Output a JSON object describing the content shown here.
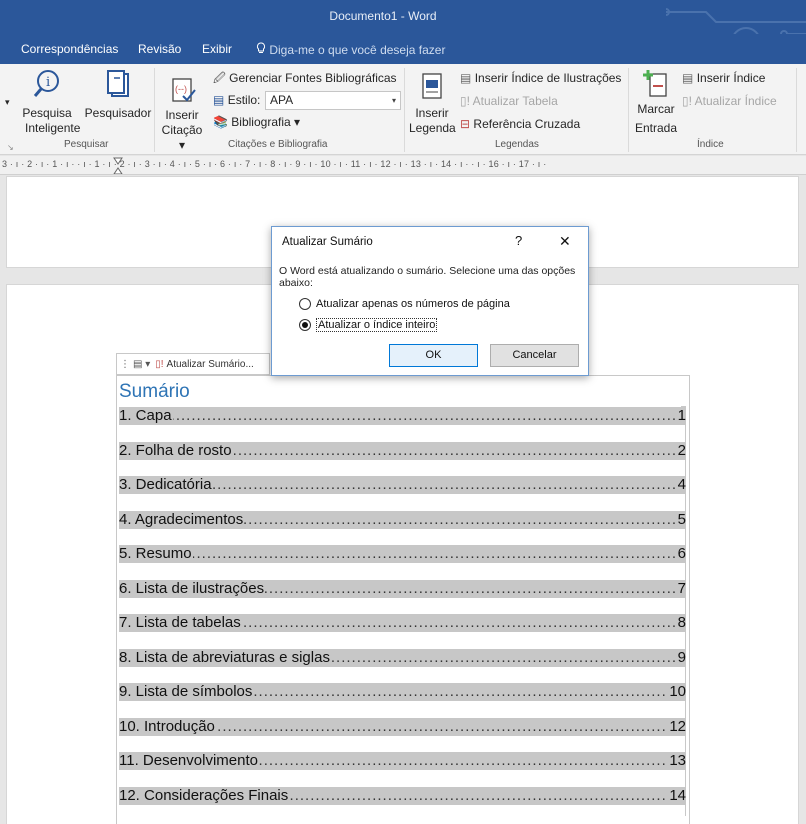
{
  "window": {
    "title": "Documento1  -  Word"
  },
  "tabs": [
    "Correspondências",
    "Revisão",
    "Exibir"
  ],
  "tellme": "Diga-me o que você deseja fazer",
  "ribbon": {
    "pesquisar": {
      "smart_lookup_line1": "Pesquisa",
      "smart_lookup_line2": "Inteligente",
      "researcher": "Pesquisador",
      "group_label": "Pesquisar"
    },
    "citacoes": {
      "insert_citation_line1": "Inserir",
      "insert_citation_line2": "Citação",
      "manage_sources": "Gerenciar Fontes Bibliográficas",
      "style_label": "Estilo:",
      "style_value": "APA",
      "bibliography": "Bibliografia",
      "group_label": "Citações e Bibliografia"
    },
    "legendas": {
      "insert_caption_line1": "Inserir",
      "insert_caption_line2": "Legenda",
      "insert_table_figures": "Inserir Índice de Ilustrações",
      "update_table": "Atualizar Tabela",
      "cross_reference": "Referência Cruzada",
      "group_label": "Legendas"
    },
    "indice": {
      "mark_entry_line1": "Marcar",
      "mark_entry_line2": "Entrada",
      "insert_index": "Inserir Índice",
      "update_index": "Atualizar Índice",
      "group_label": "Índice"
    }
  },
  "ruler": {
    "marks": "3 · ı · 2 · ı · 1 · ı ·   · ı · 1 · ı · 2 · ı · 3 · ı · 4 · ı · 5 · ı · 6 · ı · 7 · ı · 8 · ı · 9 · ı · 10 · ı · 11 · ı · 12 · ı · 13 · ı · 14 · ı ·   · ı · 16 · ı · 17 · ı ·"
  },
  "toc": {
    "update_button": "Atualizar Sumário...",
    "title": "Sumário",
    "entries": [
      {
        "label": "1. Capa",
        "page": "1"
      },
      {
        "label": "2. Folha de rosto",
        "page": "2"
      },
      {
        "label": "3. Dedicatória",
        "page": "4"
      },
      {
        "label": "4. Agradecimentos",
        "page": "5"
      },
      {
        "label": "5. Resumo",
        "page": "6"
      },
      {
        "label": "6. Lista de ilustrações",
        "page": "7"
      },
      {
        "label": "7. Lista de tabelas",
        "page": "8"
      },
      {
        "label": "8. Lista de abreviaturas e siglas",
        "page": "9"
      },
      {
        "label": "9. Lista de símbolos",
        "page": "10"
      },
      {
        "label": "10. Introdução",
        "page": "12"
      },
      {
        "label": "11. Desenvolvimento",
        "page": "13"
      },
      {
        "label": "12. Considerações Finais",
        "page": "14"
      }
    ]
  },
  "dialog": {
    "title": "Atualizar Sumário",
    "help": "?",
    "close": "✕",
    "message": "O Word está atualizando o sumário. Selecione uma das opções abaixo:",
    "option1": "Atualizar apenas os números de página",
    "option2": "Atualizar o índice inteiro",
    "selected": "option2",
    "ok": "OK",
    "cancel": "Cancelar"
  },
  "colors": {
    "titlebar": "#2b579a",
    "toc_title": "#2e74b5",
    "field_shading": "#c7c7c7",
    "dialog_border": "#6d9bd1"
  }
}
